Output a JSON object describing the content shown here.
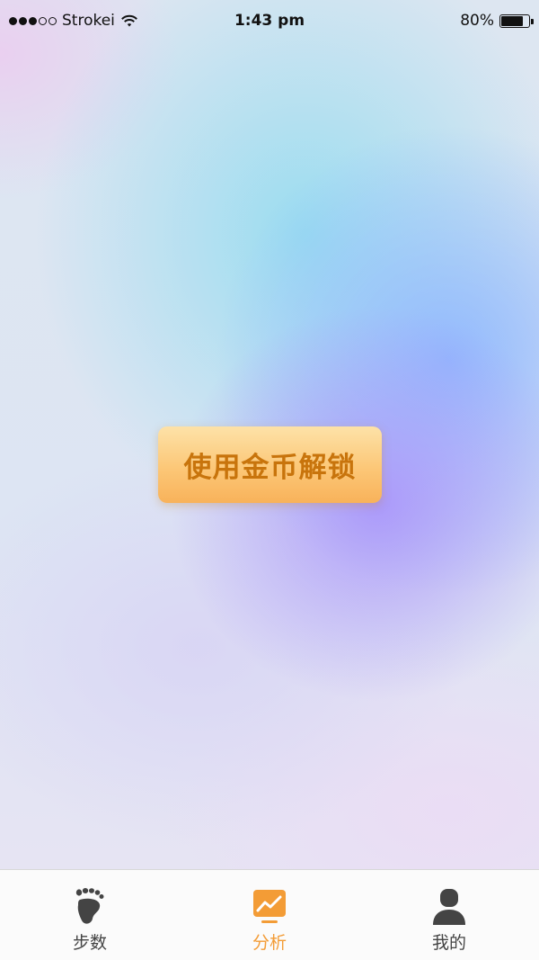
{
  "status_bar": {
    "carrier": "Strokei",
    "time": "1:43 pm",
    "battery": "80%",
    "battery_level": 0.8,
    "signal_bars_filled": 3,
    "signal_bars_total": 5
  },
  "main": {
    "unlock_button_label": "使用金币解锁"
  },
  "tab_bar": {
    "tabs": [
      {
        "label": "步数",
        "icon": "footprint-icon",
        "active": false
      },
      {
        "label": "分析",
        "icon": "chart-icon",
        "active": true
      },
      {
        "label": "我的",
        "icon": "user-icon",
        "active": false
      }
    ]
  },
  "colors": {
    "accent": "#f39c36",
    "button_text": "#c8740c",
    "inactive_tab": "#444444"
  }
}
